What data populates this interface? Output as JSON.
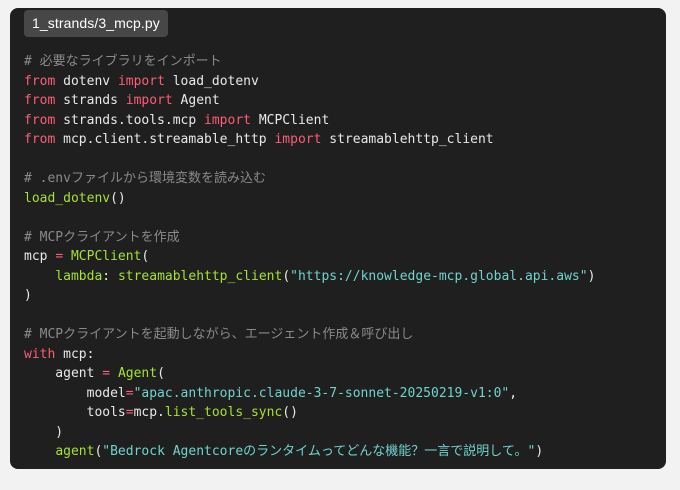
{
  "file": {
    "name": "1_strands/3_mcp.py"
  },
  "colors": {
    "background": "#1f1f1f",
    "comment": "#8a8a8a",
    "keyword": "#ff5c77",
    "function": "#a6e22e",
    "string": "#6fd3ce",
    "plain": "#e8e8e8"
  },
  "code": {
    "lines": [
      [
        {
          "t": "c",
          "v": "# 必要なライブラリをインポート"
        }
      ],
      [
        {
          "t": "k",
          "v": "from"
        },
        {
          "t": "p",
          "v": " dotenv "
        },
        {
          "t": "k",
          "v": "import"
        },
        {
          "t": "p",
          "v": " load_dotenv"
        }
      ],
      [
        {
          "t": "k",
          "v": "from"
        },
        {
          "t": "p",
          "v": " strands "
        },
        {
          "t": "k",
          "v": "import"
        },
        {
          "t": "p",
          "v": " Agent"
        }
      ],
      [
        {
          "t": "k",
          "v": "from"
        },
        {
          "t": "p",
          "v": " strands.tools.mcp "
        },
        {
          "t": "k",
          "v": "import"
        },
        {
          "t": "p",
          "v": " MCPClient"
        }
      ],
      [
        {
          "t": "k",
          "v": "from"
        },
        {
          "t": "p",
          "v": " mcp.client.streamable_http "
        },
        {
          "t": "k",
          "v": "import"
        },
        {
          "t": "p",
          "v": " streamablehttp_client"
        }
      ],
      [],
      [
        {
          "t": "c",
          "v": "# .envファイルから環境変数を読み込む"
        }
      ],
      [
        {
          "t": "f",
          "v": "load_dotenv"
        },
        {
          "t": "p",
          "v": "()"
        }
      ],
      [],
      [
        {
          "t": "c",
          "v": "# MCPクライアントを作成"
        }
      ],
      [
        {
          "t": "p",
          "v": "mcp "
        },
        {
          "t": "k",
          "v": "="
        },
        {
          "t": "p",
          "v": " "
        },
        {
          "t": "f",
          "v": "MCPClient"
        },
        {
          "t": "p",
          "v": "("
        }
      ],
      [
        {
          "t": "p",
          "v": "    "
        },
        {
          "t": "f",
          "v": "lambda"
        },
        {
          "t": "p",
          "v": ": "
        },
        {
          "t": "f",
          "v": "streamablehttp_client"
        },
        {
          "t": "p",
          "v": "("
        },
        {
          "t": "s",
          "v": "\"https://knowledge-mcp.global.api.aws\""
        },
        {
          "t": "p",
          "v": ")"
        }
      ],
      [
        {
          "t": "p",
          "v": ")"
        }
      ],
      [],
      [
        {
          "t": "c",
          "v": "# MCPクライアントを起動しながら、エージェント作成＆呼び出し"
        }
      ],
      [
        {
          "t": "k",
          "v": "with"
        },
        {
          "t": "p",
          "v": " mcp:"
        }
      ],
      [
        {
          "t": "p",
          "v": "    agent "
        },
        {
          "t": "k",
          "v": "="
        },
        {
          "t": "p",
          "v": " "
        },
        {
          "t": "f",
          "v": "Agent"
        },
        {
          "t": "p",
          "v": "("
        }
      ],
      [
        {
          "t": "p",
          "v": "        model"
        },
        {
          "t": "k",
          "v": "="
        },
        {
          "t": "s",
          "v": "\"apac.anthropic.claude-3-7-sonnet-20250219-v1:0\""
        },
        {
          "t": "p",
          "v": ","
        }
      ],
      [
        {
          "t": "p",
          "v": "        tools"
        },
        {
          "t": "k",
          "v": "="
        },
        {
          "t": "p",
          "v": "mcp."
        },
        {
          "t": "f",
          "v": "list_tools_sync"
        },
        {
          "t": "p",
          "v": "()"
        }
      ],
      [
        {
          "t": "p",
          "v": "    )"
        }
      ],
      [
        {
          "t": "p",
          "v": "    "
        },
        {
          "t": "f",
          "v": "agent"
        },
        {
          "t": "p",
          "v": "("
        },
        {
          "t": "s",
          "v": "\"Bedrock Agentcoreのランタイムってどんな機能？一言で説明して。\""
        },
        {
          "t": "p",
          "v": ")"
        }
      ]
    ]
  }
}
